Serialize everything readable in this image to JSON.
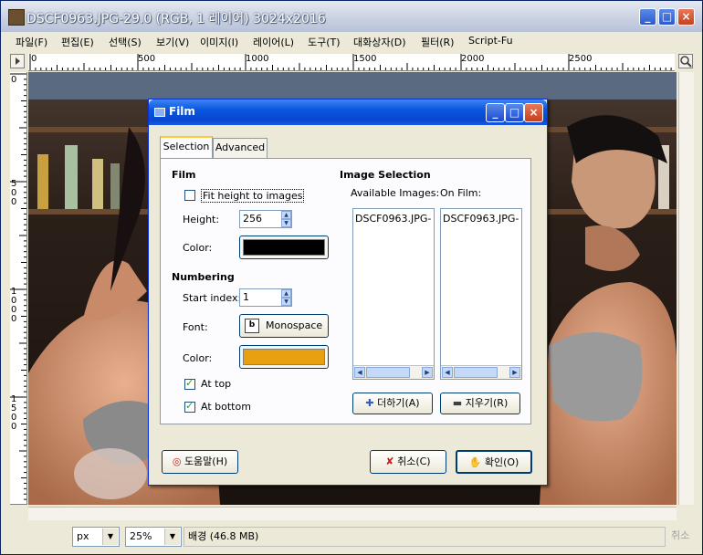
{
  "window": {
    "title": "DSCF0963.JPG-29.0 (RGB, 1 레이어) 3024x2016",
    "min_glyph": "_",
    "max_glyph": "□",
    "close_glyph": "×"
  },
  "menu": [
    "파일(F)",
    "편집(E)",
    "선택(S)",
    "보기(V)",
    "이미지(I)",
    "레이어(L)",
    "도구(T)",
    "대화상자(D)",
    "필터(R)",
    "Script-Fu"
  ],
  "ruler": {
    "h_labels": [
      "0",
      "500",
      "1000",
      "1500",
      "2000",
      "2500"
    ],
    "v_labels": [
      "0",
      "500",
      "1000",
      "1500"
    ]
  },
  "status": {
    "unit": "px",
    "zoom": "25%",
    "info": "배경 (46.8 MB)",
    "cancel_label": "취소"
  },
  "dialog": {
    "title": "Film",
    "tabs": [
      "Selection",
      "Advanced"
    ],
    "film_section": "Film",
    "fit_height_label": "Fit height to images",
    "fit_height_checked": false,
    "height_label": "Height:",
    "height_value": "256",
    "color_label": "Color:",
    "film_color": "#000000",
    "numbering_section": "Numbering",
    "start_index_label": "Start index:",
    "start_index_value": "1",
    "font_label": "Font:",
    "font_value": "Monospace",
    "font_icon_glyph": "b",
    "number_color_label": "Color:",
    "number_color": "#e8a010",
    "at_top_label": "At top",
    "at_top_checked": true,
    "at_bottom_label": "At bottom",
    "at_bottom_checked": true,
    "image_selection_section": "Image Selection",
    "available_label": "Available Images:",
    "on_film_label": "On Film:",
    "available_images": [
      "DSCF0963.JPG-"
    ],
    "on_film_images": [
      "DSCF0963.JPG-"
    ],
    "add_button": "더하기(A)",
    "remove_button": "지우기(R)",
    "help_button": "도움말(H)",
    "cancel_button": "취소(C)",
    "ok_button": "확인(O)"
  }
}
